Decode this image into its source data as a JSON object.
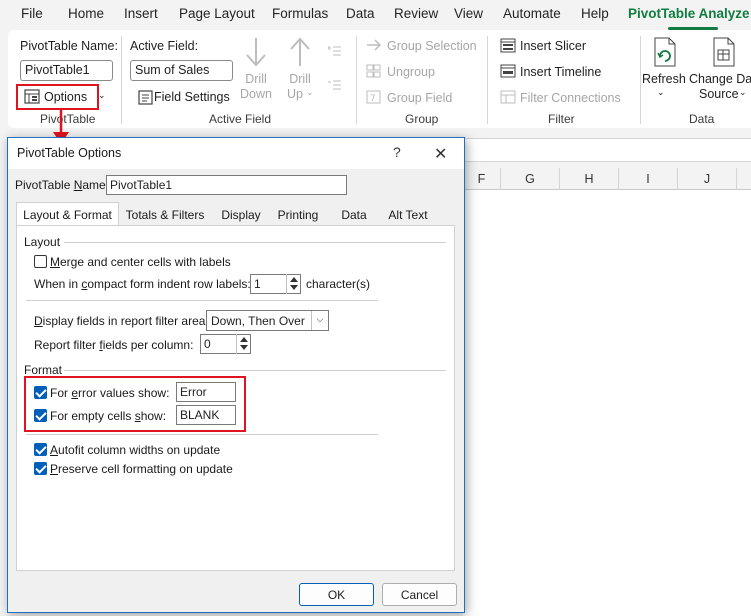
{
  "menu": {
    "items": [
      "File",
      "Home",
      "Insert",
      "Page Layout",
      "Formulas",
      "Data",
      "Review",
      "View",
      "Automate",
      "Help",
      "PivotTable Analyze"
    ],
    "active": "PivotTable Analyze"
  },
  "ribbon": {
    "pivot_name_label": "PivotTable Name:",
    "pivot_name_value": "PivotTable1",
    "options_label": "Options",
    "pivot_group": "PivotTable",
    "active_field_label": "Active Field:",
    "active_field_value": "Sum of Sales",
    "drill_down": "Drill Down",
    "drill_down_line1": "Drill",
    "drill_down_line2": "Down",
    "drill_up_line1": "Drill",
    "drill_up_line2": "Up",
    "field_settings": "Field Settings",
    "active_field_group": "Active Field",
    "group_selection": "Group Selection",
    "ungroup": "Ungroup",
    "group_field": "Group Field",
    "group_group": "Group",
    "insert_slicer": "Insert Slicer",
    "insert_timeline": "Insert Timeline",
    "filter_connections": "Filter Connections",
    "filter_group": "Filter",
    "refresh": "Refresh",
    "change_data_line1": "Change Dat",
    "change_data_line2": "Source",
    "data_group": "Data"
  },
  "sheet": {
    "columns": [
      "F",
      "G",
      "H",
      "I",
      "J"
    ]
  },
  "dialog": {
    "title": "PivotTable Options",
    "help": "?",
    "close": "✕",
    "name_label": "PivotTable Name:",
    "name_value": "PivotTable1",
    "tabs": [
      "Layout & Format",
      "Totals & Filters",
      "Display",
      "Printing",
      "Data",
      "Alt Text"
    ],
    "active_tab": "Layout & Format",
    "layout_section": "Layout",
    "merge_label": "Merge and center cells with labels",
    "merge_checked": false,
    "indent_label": "When in compact form indent row labels:",
    "indent_value": "1",
    "indent_unit": "character(s)",
    "display_fields_label": "Display fields in report filter area:",
    "display_fields_value": "Down, Then Over",
    "filter_fields_label": "Report filter fields per column:",
    "filter_fields_value": "0",
    "format_section": "Format",
    "error_label": "For error values show:",
    "error_checked": true,
    "error_value": "Error",
    "empty_label": "For empty cells show:",
    "empty_checked": true,
    "empty_value": "BLANK",
    "autofit_label": "Autofit column widths on update",
    "autofit_checked": true,
    "preserve_label": "Preserve cell formatting on update",
    "preserve_checked": true,
    "ok": "OK",
    "cancel": "Cancel"
  },
  "colors": {
    "accent_green": "#107c41",
    "highlight_red": "#e0141e",
    "checkbox_blue": "#005fb8"
  }
}
